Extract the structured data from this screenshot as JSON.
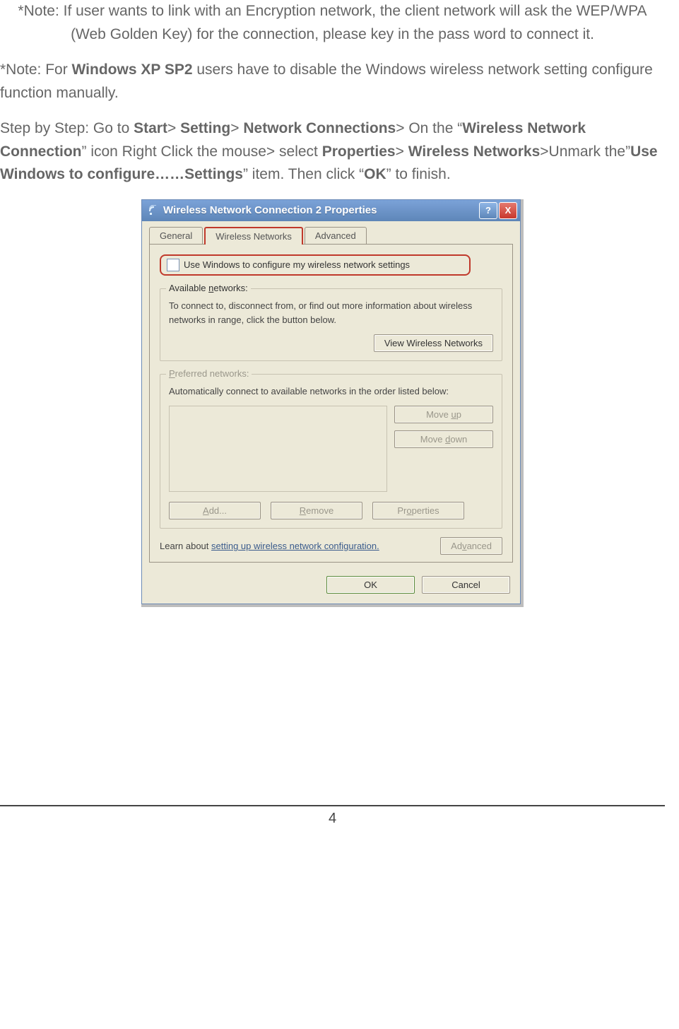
{
  "doc": {
    "note1": "*Note: If user wants to link with an Encryption network, the client network will ask the WEP/WPA (Web Golden Key) for the connection, please key in the pass word to connect it.",
    "note2_prefix": "*Note: For ",
    "note2_bold": "Windows XP SP2",
    "note2_suffix": " users have to disable the Windows wireless network setting configure function manually.",
    "step_parts": {
      "t0": "  Step by Step: Go to ",
      "b0": "Start",
      "t1": "> ",
      "b1": "Setting",
      "t2": "> ",
      "b2": "Network Connections",
      "t3": "> On the “",
      "b3": "Wireless Network Connection",
      "t4": "” icon Right Click the mouse> select ",
      "b4": "Properties",
      "t5": "> ",
      "b5": "Wireless Networks",
      "t6": ">Unmark the”",
      "b6": "Use Windows to configure……Settings",
      "t7": "” item. Then click “",
      "b7": "OK",
      "t8": "” to finish."
    },
    "page_number": "4"
  },
  "dialog": {
    "title": "Wireless Network Connection 2 Properties",
    "help_symbol": "?",
    "close_symbol": "X",
    "tabs": [
      "General",
      "Wireless Networks",
      "Advanced"
    ],
    "checkbox_label": "Use Windows to configure my wireless network settings",
    "available_group_title": "Available networks:",
    "available_text": "To connect to, disconnect from, or find out more information about wireless networks in range, click the button below.",
    "view_btn": "View Wireless Networks",
    "preferred_group_title": "Preferred networks:",
    "preferred_text": "Automatically connect to available networks in the order listed below:",
    "move_up": "Move up",
    "move_down": "Move down",
    "add": "Add...",
    "remove": "Remove",
    "properties": "Properties",
    "learn_prefix": "Learn about ",
    "learn_link": "setting up wireless network configuration.",
    "advanced_btn": "Advanced",
    "ok": "OK",
    "cancel": "Cancel"
  }
}
